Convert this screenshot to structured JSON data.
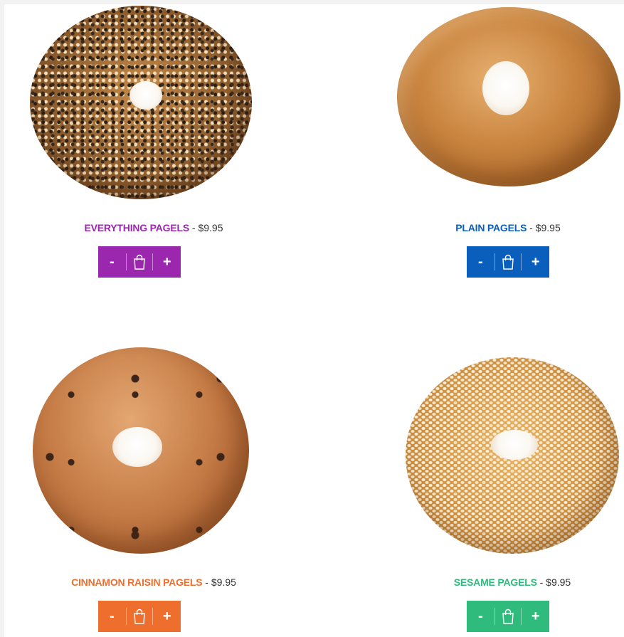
{
  "colors": {
    "purple": "#9b27af",
    "blue": "#0a5ebc",
    "orange": "#ee6f2d",
    "green": "#2ebb7c"
  },
  "buttons": {
    "minus_label": "-",
    "plus_label": "+",
    "cart_icon": "shopping-bag-icon"
  },
  "products": [
    {
      "name": "EVERYTHING PAGELS",
      "separator": " - ",
      "price": "$9.95",
      "color": "#9b27af",
      "image": "everything-bagel-photo"
    },
    {
      "name": "PLAIN PAGELS",
      "separator": " - ",
      "price": "$9.95",
      "color": "#0a5ebc",
      "image": "plain-bagel-photo"
    },
    {
      "name": "CINNAMON RAISIN PAGELS",
      "separator": " - ",
      "price": "$9.95",
      "color": "#ee6f2d",
      "image": "cinnamon-raisin-bagel-photo"
    },
    {
      "name": "SESAME PAGELS",
      "separator": " - ",
      "price": "$9.95",
      "color": "#2ebb7c",
      "image": "sesame-bagel-photo"
    }
  ]
}
